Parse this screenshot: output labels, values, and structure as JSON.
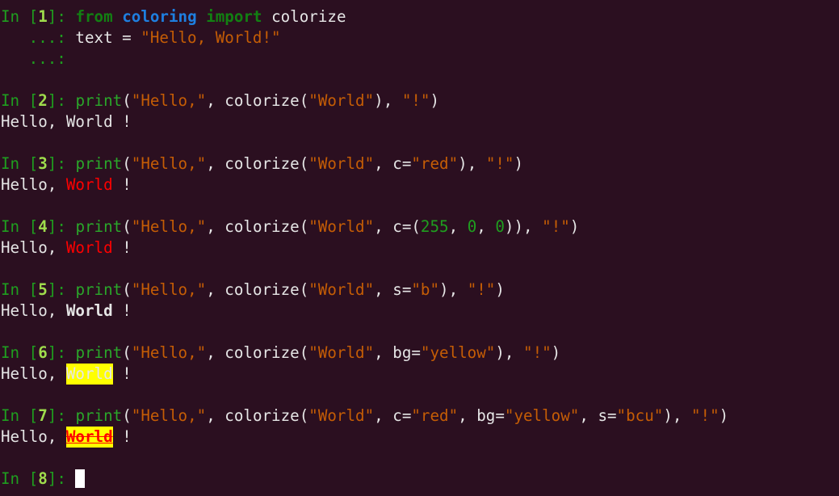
{
  "terminal": {
    "title": "IPython session",
    "background_color": "#2b0f20",
    "foreground_color": "#e6e6e6",
    "prompt_color": "#1f9e1f",
    "prompt_number_color": "#9fdc4c",
    "keyword_color": "#128012",
    "module_color": "#1e7fe0",
    "string_color": "#c55d05",
    "builtin_color": "#2aa72a",
    "number_color": "#1f9e1f",
    "highlight_yellow": "#ffff00",
    "highlight_red": "#ff0000"
  },
  "cells": [
    {
      "prompt_open": "In [",
      "prompt_num": "1",
      "prompt_close": "]: ",
      "code_line1": {
        "kw_from": "from",
        "space1": " ",
        "module": "coloring",
        "space2": " ",
        "kw_import": "import",
        "space3": " ",
        "name": "colorize"
      },
      "cont_prompt": "   ...: ",
      "code_line2_pre": "text = ",
      "code_line2_str": "\"Hello, World!\"",
      "cont_prompt_empty": "   ...:"
    },
    {
      "prompt_open": "In [",
      "prompt_num": "2",
      "prompt_close": "]: ",
      "fn": "print",
      "p1": "(",
      "s1": "\"Hello,\"",
      "p2": ", ",
      "callee": "colorize",
      "p3": "(",
      "s2": "\"World\"",
      "p4": ")",
      "p5": ", ",
      "s3": "\"!\"",
      "p6": ")",
      "out_prefix": "Hello, ",
      "out_word": "World",
      "out_suffix": " !"
    },
    {
      "prompt_open": "In [",
      "prompt_num": "3",
      "prompt_close": "]: ",
      "fn": "print",
      "p1": "(",
      "s1": "\"Hello,\"",
      "p2": ", ",
      "callee": "colorize",
      "p3": "(",
      "s2": "\"World\"",
      "p4": ", ",
      "kwarg1": "c=",
      "kwval1": "\"red\"",
      "p5": ")",
      "p6": ", ",
      "s3": "\"!\"",
      "p7": ")",
      "out_prefix": "Hello, ",
      "out_word": "World",
      "out_suffix": " !"
    },
    {
      "prompt_open": "In [",
      "prompt_num": "4",
      "prompt_close": "]: ",
      "fn": "print",
      "p1": "(",
      "s1": "\"Hello,\"",
      "p2": ", ",
      "callee": "colorize",
      "p3": "(",
      "s2": "\"World\"",
      "p4": ", ",
      "kwarg1": "c=(",
      "n1": "255",
      "c1": ", ",
      "n2": "0",
      "c2": ", ",
      "n3": "0",
      "p5": "))",
      "p6": ", ",
      "s3": "\"!\"",
      "p7": ")",
      "out_prefix": "Hello, ",
      "out_word": "World",
      "out_suffix": " !"
    },
    {
      "prompt_open": "In [",
      "prompt_num": "5",
      "prompt_close": "]: ",
      "fn": "print",
      "p1": "(",
      "s1": "\"Hello,\"",
      "p2": ", ",
      "callee": "colorize",
      "p3": "(",
      "s2": "\"World\"",
      "p4": ", ",
      "kwarg1": "s=",
      "kwval1": "\"b\"",
      "p5": ")",
      "p6": ", ",
      "s3": "\"!\"",
      "p7": ")",
      "out_prefix": "Hello, ",
      "out_word": "World",
      "out_suffix": " !"
    },
    {
      "prompt_open": "In [",
      "prompt_num": "6",
      "prompt_close": "]: ",
      "fn": "print",
      "p1": "(",
      "s1": "\"Hello,\"",
      "p2": ", ",
      "callee": "colorize",
      "p3": "(",
      "s2": "\"World\"",
      "p4": ", ",
      "kwarg1": "bg=",
      "kwval1": "\"yellow\"",
      "p5": ")",
      "p6": ", ",
      "s3": "\"!\"",
      "p7": ")",
      "out_prefix": "Hello, ",
      "out_word": "World",
      "out_suffix": " !"
    },
    {
      "prompt_open": "In [",
      "prompt_num": "7",
      "prompt_close": "]: ",
      "fn": "print",
      "p1": "(",
      "s1": "\"Hello,\"",
      "p2": ", ",
      "callee": "colorize",
      "p3": "(",
      "s2": "\"World\"",
      "p4": ", ",
      "kwarg1": "c=",
      "kwval1": "\"red\"",
      "sep1": ", ",
      "kwarg2": "bg=",
      "kwval2": "\"yellow\"",
      "sep2": ", ",
      "kwarg3": "s=",
      "kwval3": "\"bcu\"",
      "p5": ")",
      "p6": ", ",
      "s3": "\"!\"",
      "p7": ")",
      "out_prefix": "Hello, ",
      "out_word": "World",
      "out_suffix": " !"
    },
    {
      "prompt_open": "In [",
      "prompt_num": "8",
      "prompt_close": "]: ",
      "cursor": ""
    }
  ]
}
